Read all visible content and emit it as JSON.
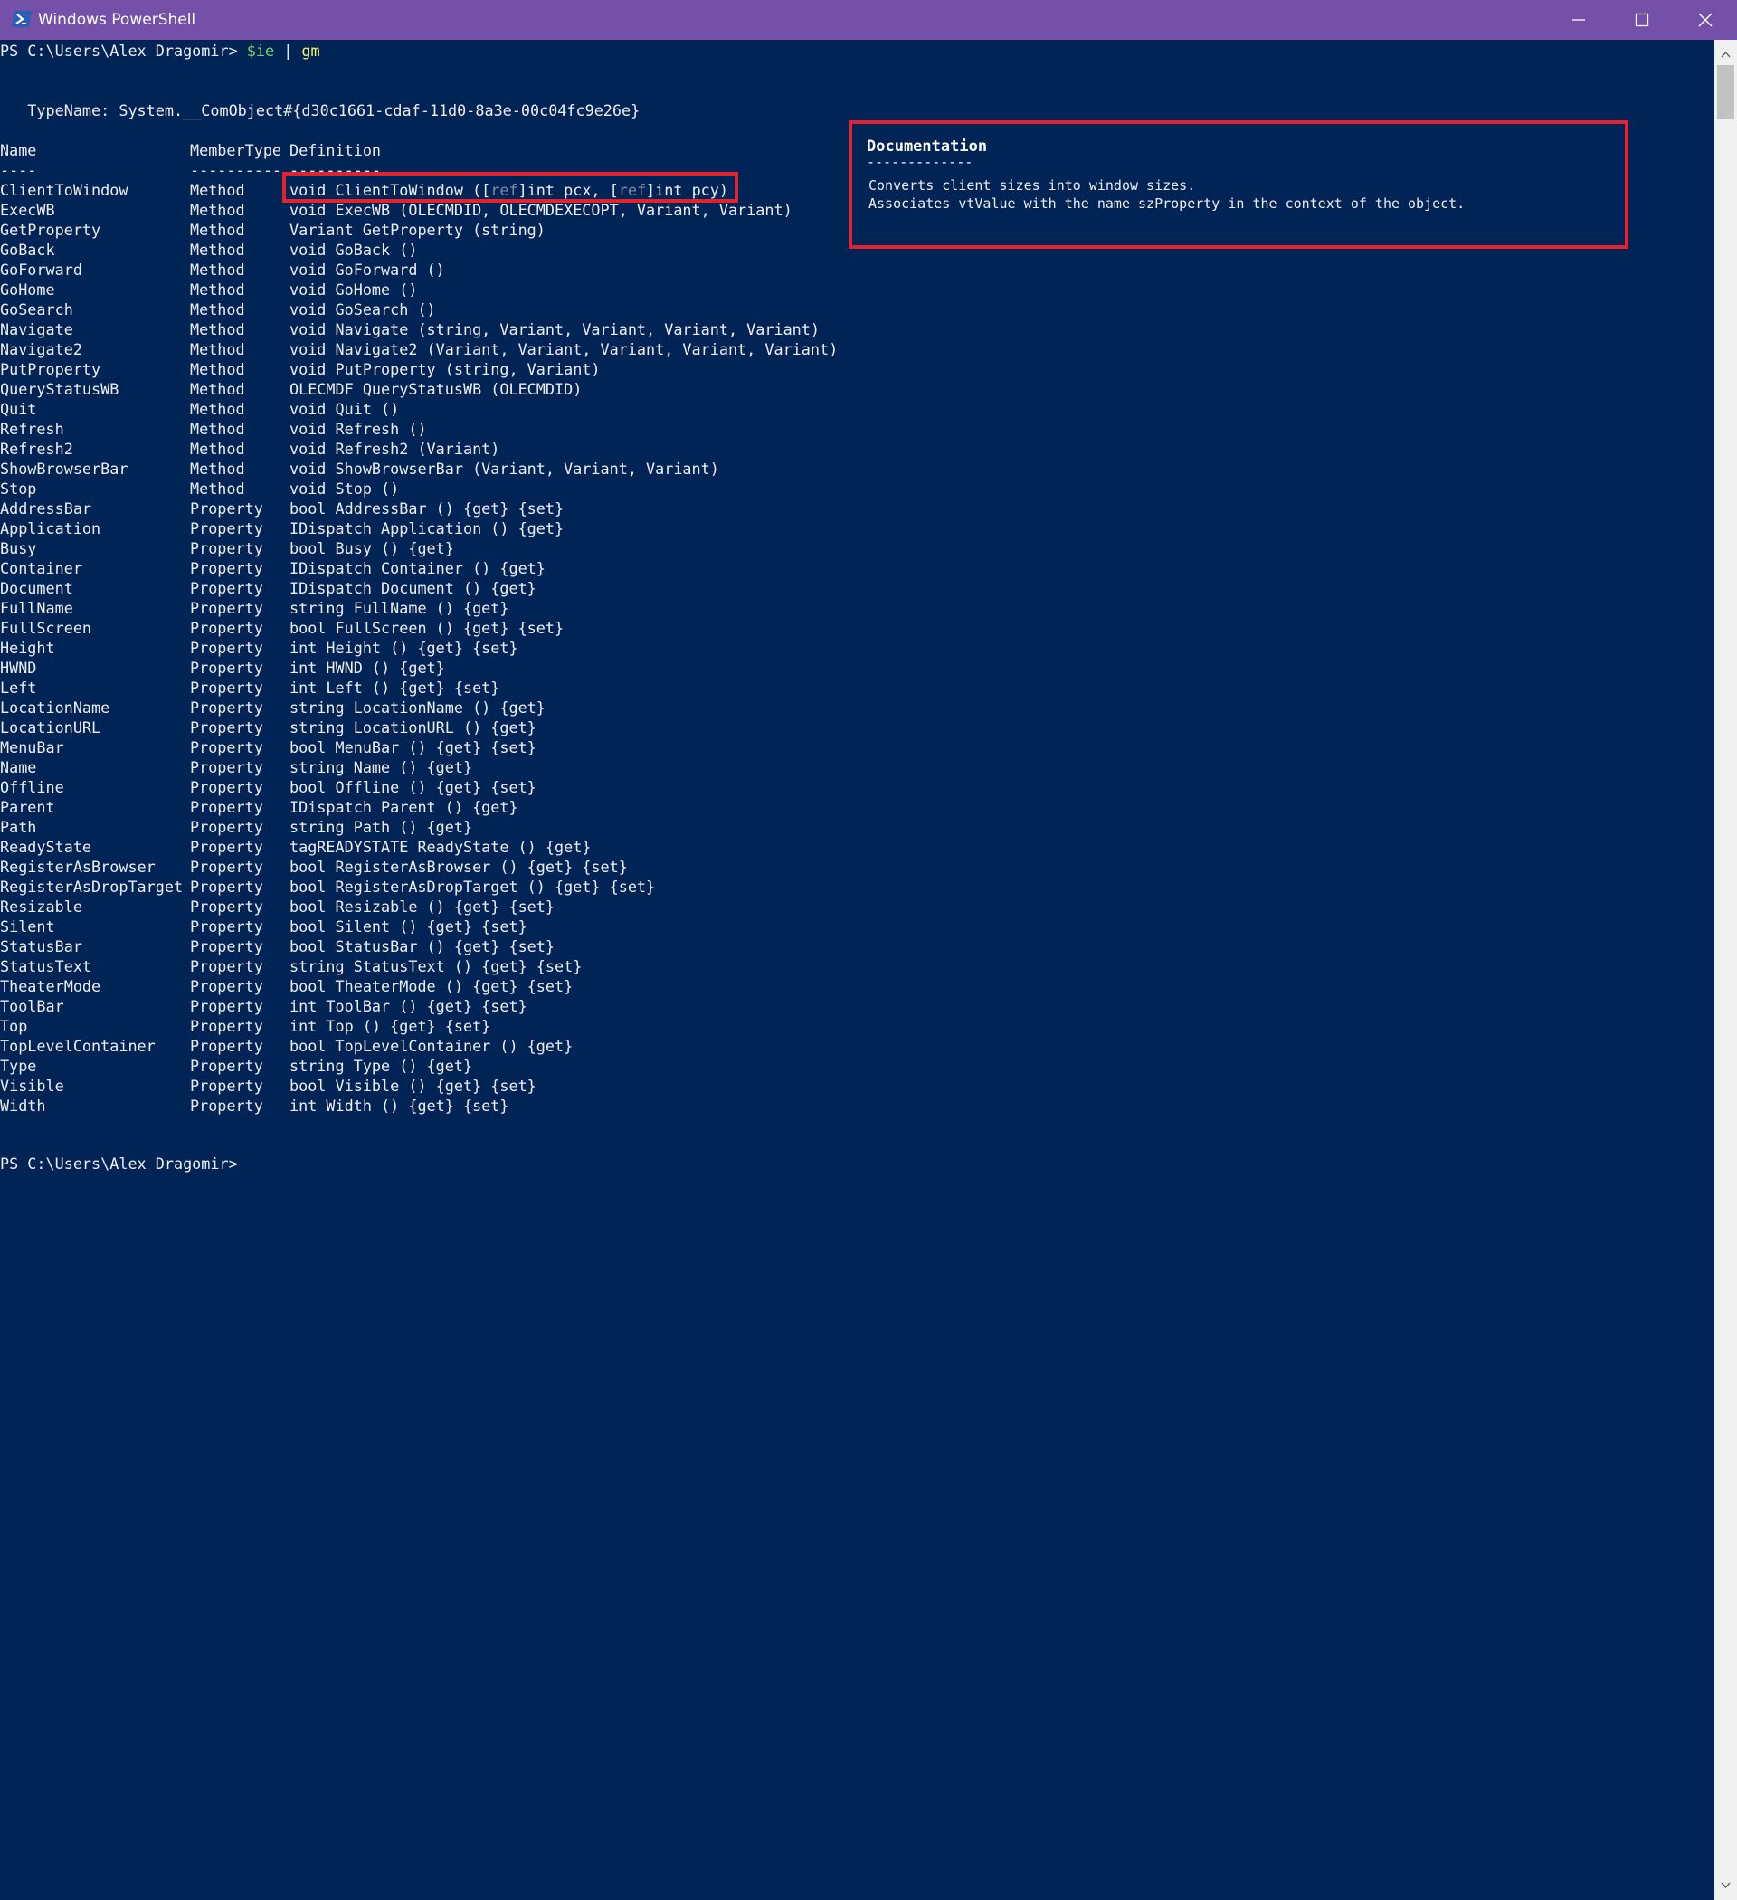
{
  "window": {
    "title": "Windows PowerShell",
    "icon": "powershell-icon",
    "controls": [
      "minimize-icon",
      "maximize-icon",
      "close-icon"
    ],
    "colors": {
      "titlebar": "#7450a8",
      "console_background": "#012456",
      "console_text": "#eeedf0",
      "highlight_border": "#e2222d",
      "command_variable": "#6bd96b",
      "command_word": "#f3f36a"
    }
  },
  "console": {
    "prompt_start": "PS C:\\Users\\Alex Dragomir> ",
    "command_variable": "$ie",
    "command_pipe": " | ",
    "command_cmdlet": "gm",
    "type_name": "   TypeName: System.__ComObject#{d30c1661-cdaf-11d0-8a3e-00c04fc9e26e}",
    "headers": {
      "name": "Name",
      "member_type": "MemberType",
      "definition": "Definition"
    },
    "separators": {
      "name": "----",
      "member_type": "----------",
      "definition": "----------"
    },
    "highlighted_definition": {
      "part1": "void ClientToWindow ([",
      "ref1": "ref",
      "part2": "]int pcx, [",
      "ref2": "ref",
      "part3": "]int pcy)"
    },
    "rows": [
      {
        "name": "ClientToWindow",
        "type": "Method",
        "def": "void ClientToWindow ([ref]int pcx, [ref]int pcy)"
      },
      {
        "name": "ExecWB",
        "type": "Method",
        "def": "void ExecWB (OLECMDID, OLECMDEXECOPT, Variant, Variant)"
      },
      {
        "name": "GetProperty",
        "type": "Method",
        "def": "Variant GetProperty (string)"
      },
      {
        "name": "GoBack",
        "type": "Method",
        "def": "void GoBack ()"
      },
      {
        "name": "GoForward",
        "type": "Method",
        "def": "void GoForward ()"
      },
      {
        "name": "GoHome",
        "type": "Method",
        "def": "void GoHome ()"
      },
      {
        "name": "GoSearch",
        "type": "Method",
        "def": "void GoSearch ()"
      },
      {
        "name": "Navigate",
        "type": "Method",
        "def": "void Navigate (string, Variant, Variant, Variant, Variant)"
      },
      {
        "name": "Navigate2",
        "type": "Method",
        "def": "void Navigate2 (Variant, Variant, Variant, Variant, Variant)"
      },
      {
        "name": "PutProperty",
        "type": "Method",
        "def": "void PutProperty (string, Variant)"
      },
      {
        "name": "QueryStatusWB",
        "type": "Method",
        "def": "OLECMDF QueryStatusWB (OLECMDID)"
      },
      {
        "name": "Quit",
        "type": "Method",
        "def": "void Quit ()"
      },
      {
        "name": "Refresh",
        "type": "Method",
        "def": "void Refresh ()"
      },
      {
        "name": "Refresh2",
        "type": "Method",
        "def": "void Refresh2 (Variant)"
      },
      {
        "name": "ShowBrowserBar",
        "type": "Method",
        "def": "void ShowBrowserBar (Variant, Variant, Variant)"
      },
      {
        "name": "Stop",
        "type": "Method",
        "def": "void Stop ()"
      },
      {
        "name": "AddressBar",
        "type": "Property",
        "def": "bool AddressBar () {get} {set}"
      },
      {
        "name": "Application",
        "type": "Property",
        "def": "IDispatch Application () {get}"
      },
      {
        "name": "Busy",
        "type": "Property",
        "def": "bool Busy () {get}"
      },
      {
        "name": "Container",
        "type": "Property",
        "def": "IDispatch Container () {get}"
      },
      {
        "name": "Document",
        "type": "Property",
        "def": "IDispatch Document () {get}"
      },
      {
        "name": "FullName",
        "type": "Property",
        "def": "string FullName () {get}"
      },
      {
        "name": "FullScreen",
        "type": "Property",
        "def": "bool FullScreen () {get} {set}"
      },
      {
        "name": "Height",
        "type": "Property",
        "def": "int Height () {get} {set}"
      },
      {
        "name": "HWND",
        "type": "Property",
        "def": "int HWND () {get}"
      },
      {
        "name": "Left",
        "type": "Property",
        "def": "int Left () {get} {set}"
      },
      {
        "name": "LocationName",
        "type": "Property",
        "def": "string LocationName () {get}"
      },
      {
        "name": "LocationURL",
        "type": "Property",
        "def": "string LocationURL () {get}"
      },
      {
        "name": "MenuBar",
        "type": "Property",
        "def": "bool MenuBar () {get} {set}"
      },
      {
        "name": "Name",
        "type": "Property",
        "def": "string Name () {get}"
      },
      {
        "name": "Offline",
        "type": "Property",
        "def": "bool Offline () {get} {set}"
      },
      {
        "name": "Parent",
        "type": "Property",
        "def": "IDispatch Parent () {get}"
      },
      {
        "name": "Path",
        "type": "Property",
        "def": "string Path () {get}"
      },
      {
        "name": "ReadyState",
        "type": "Property",
        "def": "tagREADYSTATE ReadyState () {get}"
      },
      {
        "name": "RegisterAsBrowser",
        "type": "Property",
        "def": "bool RegisterAsBrowser () {get} {set}"
      },
      {
        "name": "RegisterAsDropTarget",
        "type": "Property",
        "def": "bool RegisterAsDropTarget () {get} {set}"
      },
      {
        "name": "Resizable",
        "type": "Property",
        "def": "bool Resizable () {get} {set}"
      },
      {
        "name": "Silent",
        "type": "Property",
        "def": "bool Silent () {get} {set}"
      },
      {
        "name": "StatusBar",
        "type": "Property",
        "def": "bool StatusBar () {get} {set}"
      },
      {
        "name": "StatusText",
        "type": "Property",
        "def": "string StatusText () {get} {set}"
      },
      {
        "name": "TheaterMode",
        "type": "Property",
        "def": "bool TheaterMode () {get} {set}"
      },
      {
        "name": "ToolBar",
        "type": "Property",
        "def": "int ToolBar () {get} {set}"
      },
      {
        "name": "Top",
        "type": "Property",
        "def": "int Top () {get} {set}"
      },
      {
        "name": "TopLevelContainer",
        "type": "Property",
        "def": "bool TopLevelContainer () {get}"
      },
      {
        "name": "Type",
        "type": "Property",
        "def": "string Type () {get}"
      },
      {
        "name": "Visible",
        "type": "Property",
        "def": "bool Visible () {get} {set}"
      },
      {
        "name": "Width",
        "type": "Property",
        "def": "int Width () {get} {set}"
      }
    ],
    "prompt_end": "PS C:\\Users\\Alex Dragomir>"
  },
  "documentation": {
    "title": "Documentation",
    "separator": "-------------",
    "lines": [
      "Converts client sizes into window sizes.",
      "Associates vtValue with the name szProperty in the context of the object."
    ]
  },
  "scrollbar": {
    "up_icon": "scroll-up-arrow-icon",
    "down_icon": "scroll-down-arrow-icon"
  }
}
